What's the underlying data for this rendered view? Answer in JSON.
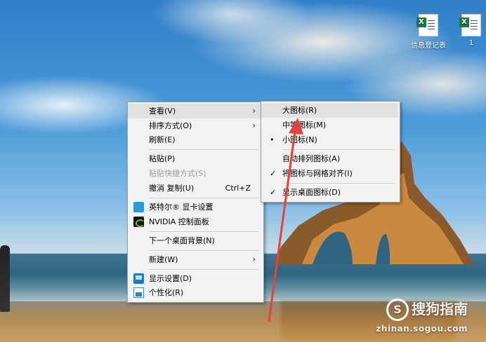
{
  "desktop_icons": [
    {
      "name": "信息登记表",
      "icon": "excel-file-icon"
    },
    {
      "name": "1",
      "icon": "excel-file-icon"
    }
  ],
  "context_menu": {
    "items": [
      {
        "label": "查看(V)",
        "has_submenu": true,
        "highlighted": true
      },
      {
        "label": "排序方式(O)",
        "has_submenu": true
      },
      {
        "label": "刷新(E)"
      },
      {
        "label": "粘贴(P)"
      },
      {
        "label": "粘贴快捷方式(S)",
        "disabled": true
      },
      {
        "label": "撤消 复制(U)",
        "shortcut": "Ctrl+Z"
      },
      {
        "label": "英特尔® 显卡设置",
        "icon": "intel-graphics-icon"
      },
      {
        "label": "NVIDIA 控制面板",
        "icon": "nvidia-icon"
      },
      {
        "label": "下一个桌面背景(N)"
      },
      {
        "label": "新建(W)",
        "has_submenu": true
      },
      {
        "label": "显示设置(D)",
        "icon": "display-settings-icon"
      },
      {
        "label": "个性化(R)",
        "icon": "personalize-icon"
      }
    ]
  },
  "view_submenu": {
    "items": [
      {
        "label": "大图标(R)",
        "highlighted": true
      },
      {
        "label": "中等图标(M)"
      },
      {
        "label": "小图标(N)",
        "mark": "•",
        "selected": true
      },
      {
        "label": "自动排列图标(A)"
      },
      {
        "label": "将图标与网格对齐(I)",
        "mark": "✓",
        "checked": true
      },
      {
        "label": "显示桌面图标(D)",
        "mark": "✓",
        "checked": true
      }
    ]
  },
  "watermark": {
    "brand": "搜狗指南",
    "logo_letter": "S",
    "url": "zhinan.sogou.com"
  },
  "colors": {
    "menu_bg": "#f2f2f2",
    "highlight": "#e1e1e1",
    "arrow": "#e8413a"
  }
}
